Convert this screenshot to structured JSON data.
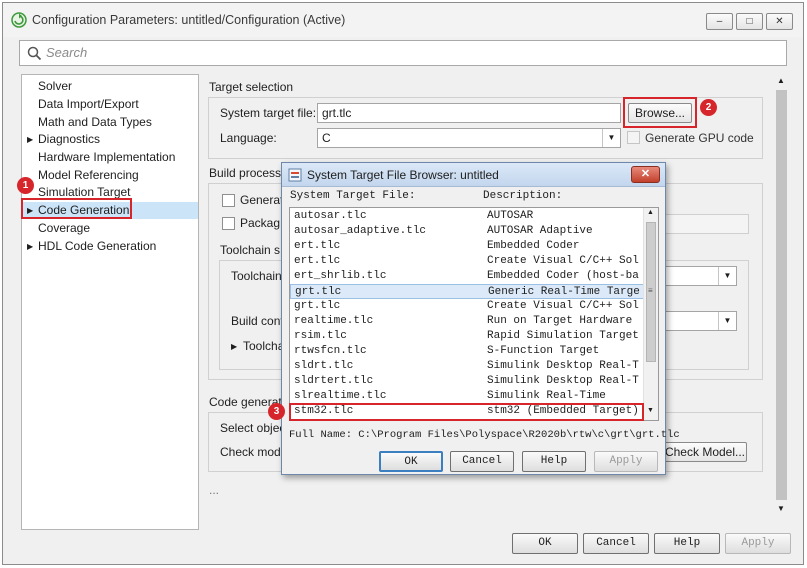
{
  "window": {
    "title": "Configuration Parameters: untitled/Configuration (Active)",
    "minimize": "–",
    "maximize": "□",
    "close": "✕"
  },
  "search": {
    "placeholder": "Search"
  },
  "nav": {
    "items": [
      {
        "label": "Solver",
        "arrow": ""
      },
      {
        "label": "Data Import/Export",
        "arrow": ""
      },
      {
        "label": "Math and Data Types",
        "arrow": ""
      },
      {
        "label": "Diagnostics",
        "arrow": "▶"
      },
      {
        "label": "Hardware Implementation",
        "arrow": ""
      },
      {
        "label": "Model Referencing",
        "arrow": ""
      },
      {
        "label": "Simulation Target",
        "arrow": ""
      },
      {
        "label": "Code Generation",
        "arrow": "▶"
      },
      {
        "label": "Coverage",
        "arrow": ""
      },
      {
        "label": "HDL Code Generation",
        "arrow": "▶"
      }
    ],
    "selected": "Code Generation"
  },
  "badges": {
    "one": "1",
    "two": "2",
    "three": "3"
  },
  "target_selection": {
    "heading": "Target selection",
    "system_target_label": "System target file:",
    "system_target_value": "grt.tlc",
    "browse_label": "Browse...",
    "language_label": "Language:",
    "language_value": "C",
    "gpu_label": "Generate GPU code"
  },
  "build_process": {
    "heading": "Build process",
    "generate_label": "Generat",
    "package_label": "Packag",
    "toolchain_heading": "Toolchain s",
    "toolchain_label": "Toolchain",
    "build_config_label": "Build conf",
    "toolchain_details": "Toolcha"
  },
  "code_gen": {
    "heading": "Code generat",
    "select_objective_label": "Select objec",
    "check_model_label": "Check mod",
    "check_model_button": "Check Model...",
    "ellipsis": "..."
  },
  "footer_buttons": {
    "ok": "OK",
    "cancel": "Cancel",
    "help": "Help",
    "apply": "Apply"
  },
  "dialog": {
    "title": "System Target File Browser: untitled",
    "col_file": "System Target File:",
    "col_desc": "Description:",
    "rows": [
      {
        "file": "autosar.tlc",
        "desc": "AUTOSAR"
      },
      {
        "file": "autosar_adaptive.tlc",
        "desc": "AUTOSAR Adaptive"
      },
      {
        "file": "ert.tlc",
        "desc": "Embedded Coder"
      },
      {
        "file": "ert.tlc",
        "desc": "Create Visual C/C++ Sol"
      },
      {
        "file": "ert_shrlib.tlc",
        "desc": "Embedded Coder (host-ba"
      },
      {
        "file": "grt.tlc",
        "desc": "Generic Real-Time Targe"
      },
      {
        "file": "grt.tlc",
        "desc": "Create Visual C/C++ Sol"
      },
      {
        "file": "realtime.tlc",
        "desc": "Run on Target Hardware"
      },
      {
        "file": "rsim.tlc",
        "desc": "Rapid Simulation Target"
      },
      {
        "file": "rtwsfcn.tlc",
        "desc": "S-Function Target"
      },
      {
        "file": "sldrt.tlc",
        "desc": "Simulink Desktop Real-T"
      },
      {
        "file": "sldrtert.tlc",
        "desc": "Simulink Desktop Real-T"
      },
      {
        "file": "slrealtime.tlc",
        "desc": "Simulink Real-Time"
      },
      {
        "file": "stm32.tlc",
        "desc": "stm32 (Embedded Target)"
      }
    ],
    "selected_file": "grt.tlc",
    "full_name": "Full Name: C:\\Program Files\\Polyspace\\R2020b\\rtw\\c\\grt\\grt.tlc",
    "ok": "OK",
    "cancel": "Cancel",
    "help": "Help",
    "apply": "Apply"
  },
  "colors": {
    "highlight": "#d7262b",
    "selection": "#cce4f7",
    "dialog_title": "#c3d6ee"
  }
}
